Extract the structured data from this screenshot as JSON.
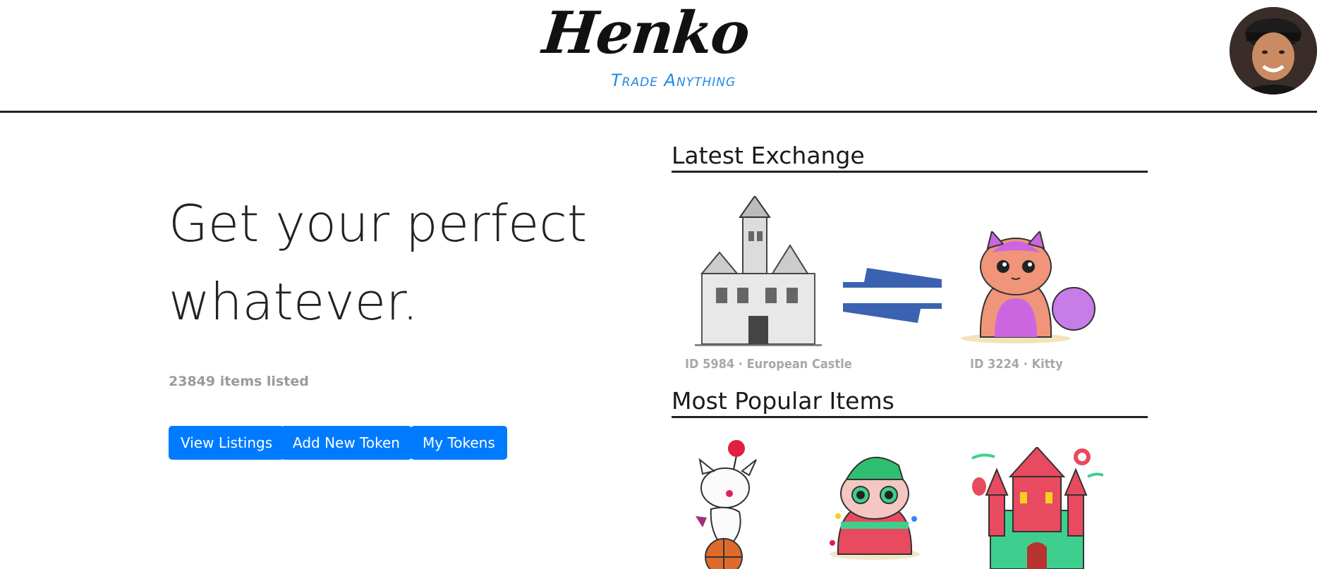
{
  "header": {
    "logo_text": "Henko",
    "logo_tagline": "Trade Anything"
  },
  "hero": {
    "title_line1": "Get your perfect",
    "title_line2": "whatever.",
    "items_listed": "23849 items listed",
    "buttons": {
      "view_listings": "View Listings",
      "add_new_token": "Add New Token",
      "my_tokens": "My Tokens"
    }
  },
  "latest_exchange": {
    "title": "Latest Exchange",
    "from_item": {
      "caption": "ID 5984 · European Castle",
      "image": "castle-image"
    },
    "to_item": {
      "caption": "ID 3224 · Kitty",
      "image": "kitty-image"
    },
    "exchange_icon": "swap-arrows-icon"
  },
  "popular": {
    "title": "Most Popular Items",
    "items": [
      {
        "image": "moogle-image"
      },
      {
        "image": "elf-cat-image"
      },
      {
        "image": "fairy-castle-image"
      }
    ]
  },
  "colors": {
    "primary": "#007bff",
    "tagline": "#1e88e5",
    "arrows": "#3b62b0",
    "caption": "#a8a8a8"
  }
}
